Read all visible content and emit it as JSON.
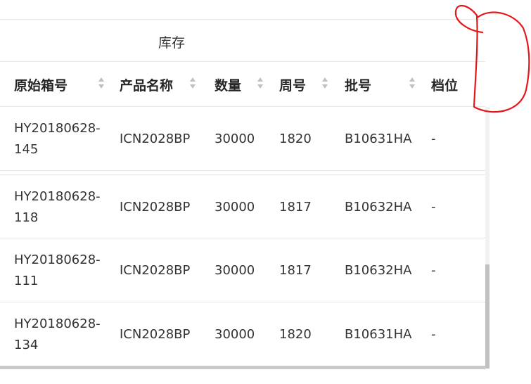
{
  "table": {
    "group_header": "库存",
    "columns": [
      {
        "key": "box_id",
        "label": "原始箱号",
        "sortable": true
      },
      {
        "key": "product_name",
        "label": "产品名称",
        "sortable": true
      },
      {
        "key": "quantity",
        "label": "数量",
        "sortable": true
      },
      {
        "key": "week",
        "label": "周号",
        "sortable": true
      },
      {
        "key": "batch",
        "label": "批号",
        "sortable": true
      },
      {
        "key": "grade",
        "label": "档位",
        "sortable": false
      }
    ],
    "rows": [
      {
        "box_id": "HY20180628-145",
        "product_name": "ICN2028BP",
        "quantity": "30000",
        "week": "1820",
        "batch": "B10631HA",
        "grade": "-"
      },
      {
        "box_id": "HY20180628-118",
        "product_name": "ICN2028BP",
        "quantity": "30000",
        "week": "1817",
        "batch": "B10632HA",
        "grade": "-"
      },
      {
        "box_id": "HY20180628-111",
        "product_name": "ICN2028BP",
        "quantity": "30000",
        "week": "1817",
        "batch": "B10632HA",
        "grade": "-"
      },
      {
        "box_id": "HY20180628-134",
        "product_name": "ICN2028BP",
        "quantity": "30000",
        "week": "1820",
        "batch": "B10631HA",
        "grade": "-"
      }
    ]
  },
  "annotation": {
    "color": "#e5171b",
    "shape": "hand-drawn-circle"
  },
  "colors": {
    "border": "#e8e8e8",
    "sorter": "#bfbfbf",
    "scrollbar_thumb": "#c1c1c1"
  }
}
